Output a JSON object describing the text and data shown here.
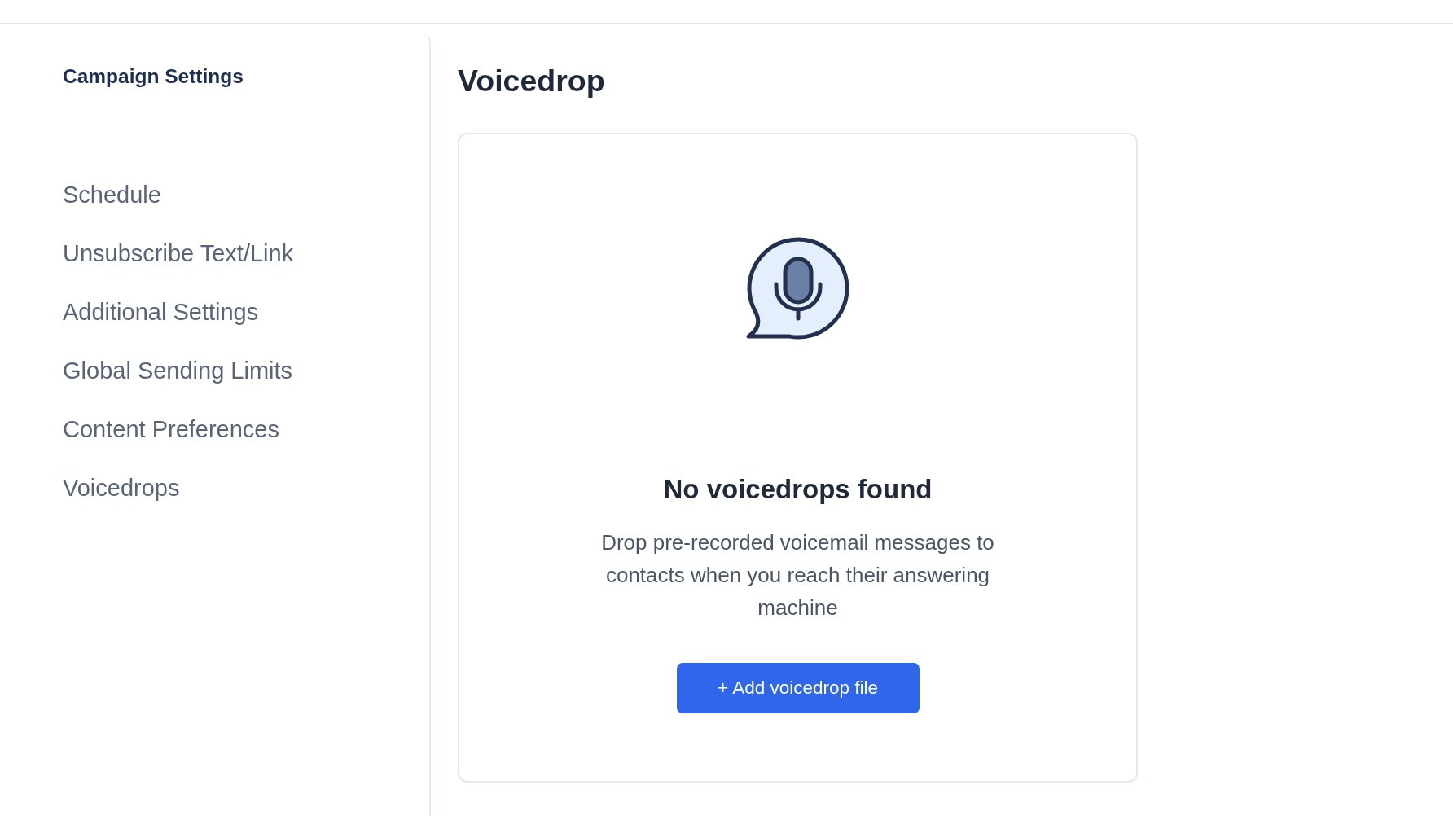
{
  "sidebar": {
    "title": "Campaign Settings",
    "items": [
      "Schedule",
      "Unsubscribe Text/Link",
      "Additional Settings",
      "Global Sending Limits",
      "Content Preferences",
      "Voicedrops"
    ]
  },
  "page": {
    "title": "Voicedrop"
  },
  "empty_state": {
    "title": "No voicedrops found",
    "description": "Drop pre-recorded voicemail messages to contacts when you reach their answering machine",
    "button": "+ Add voicedrop file"
  }
}
